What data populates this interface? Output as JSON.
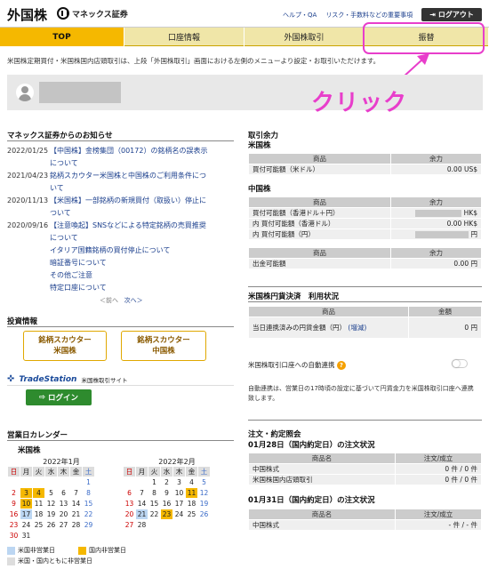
{
  "header": {
    "title": "外国株",
    "brand": "マネックス証券",
    "links": [
      "ヘルプ・QA",
      "リスク・手数料などの重要事項"
    ],
    "logout": "ログアウト"
  },
  "nav": {
    "tabs": [
      "TOP",
      "口座情報",
      "外国株取引",
      "振替"
    ]
  },
  "info_text": "米国株定期買付・米国株国内店頭取引は、上段「外国株取引」画面における左側のメニューより設定・お取引いただけます。",
  "annotation": "クリック",
  "news": {
    "title": "マネックス証券からのお知らせ",
    "items": [
      {
        "date": "2022/01/25",
        "lines": [
          "【中国株】金榜集団（00172）の銘柄名の誤表示",
          "について"
        ]
      },
      {
        "date": "2021/04/23",
        "lines": [
          "銘柄スカウター米国株と中国株のご利用条件につ",
          "いて"
        ]
      },
      {
        "date": "2020/11/13",
        "lines": [
          "【米国株】一部銘柄の新規買付（取扱い）停止に",
          "ついて"
        ]
      },
      {
        "date": "2020/09/16",
        "lines": [
          "【注意喚起】SNSなどによる特定銘柄の売買推奨",
          "について",
          "イタリア国籍銘柄の買付停止について",
          "暗証番号について",
          "その他ご注意",
          "特定口座について"
        ]
      }
    ],
    "prev": "＜前へ",
    "next": "次へ＞"
  },
  "invest": {
    "title": "投資情報",
    "buttons": [
      {
        "l1": "銘柄スカウター",
        "l2": "米国株"
      },
      {
        "l1": "銘柄スカウター",
        "l2": "中国株"
      }
    ]
  },
  "tradestation": {
    "logo": "TradeStation",
    "label": "米国株取引サイト",
    "login": "ログイン"
  },
  "calendar": {
    "title": "営業日カレンダー",
    "subtitle": "米国株",
    "weekdays": [
      "日",
      "月",
      "火",
      "水",
      "木",
      "金",
      "土"
    ],
    "months": [
      {
        "title": "2022年1月",
        "weeks": [
          [
            "",
            "",
            "",
            "",
            "",
            "",
            "1"
          ],
          [
            "2",
            "3",
            "4",
            "5",
            "6",
            "7",
            "8"
          ],
          [
            "9",
            "10",
            "11",
            "12",
            "13",
            "14",
            "15"
          ],
          [
            "16",
            "17",
            "18",
            "19",
            "20",
            "21",
            "22"
          ],
          [
            "23",
            "24",
            "25",
            "26",
            "27",
            "28",
            "29"
          ],
          [
            "30",
            "31",
            "",
            "",
            "",
            "",
            ""
          ]
        ]
      },
      {
        "title": "2022年2月",
        "weeks": [
          [
            "",
            "",
            "1",
            "2",
            "3",
            "4",
            "5"
          ],
          [
            "6",
            "7",
            "8",
            "9",
            "10",
            "11",
            "12"
          ],
          [
            "13",
            "14",
            "15",
            "16",
            "17",
            "18",
            "19"
          ],
          [
            "20",
            "21",
            "22",
            "23",
            "24",
            "25",
            "26"
          ],
          [
            "27",
            "28",
            "",
            "",
            "",
            "",
            ""
          ]
        ]
      }
    ],
    "legend": [
      "米国非営業日",
      "国内非営業日",
      "米国・国内ともに非営業日"
    ]
  },
  "balance": {
    "title": "取引余力",
    "us_title": "米国株",
    "cn_title": "中国株",
    "col_item": "商品",
    "col_amount": "余力",
    "us_rows": [
      {
        "label": "買付可能額（米ドル）",
        "value": "0.00 US$"
      }
    ],
    "cn_rows": [
      {
        "label": "買付可能額（香港ドル＋円）",
        "value": "HK$"
      },
      {
        "label": "内 買付可能額（香港ドル）",
        "value": "0.00 HK$"
      },
      {
        "label": "内 買付可能額（円）",
        "value": "円"
      }
    ],
    "out_row": {
      "label": "出金可能額",
      "value": "0.00 円"
    }
  },
  "yen_settle": {
    "title": "米国株円貨決済　利用状況",
    "col_item": "商品",
    "col_amount": "金額",
    "label": "当日連携済みの円貨金額（円）",
    "link": "(増減)",
    "value": "0 円",
    "auto_label": "米国株取引口座への自動連携",
    "note": "自動連携は、営業日の17時頃の設定に基づいて円貨金力を米国株取引口座へ連携致します。"
  },
  "orders": {
    "title": "注文・約定照会",
    "sub1": "01月28日（国内約定日）の注文状況",
    "sub2": "01月31日（国内約定日）の注文状況",
    "col_item": "商品名",
    "col_status": "注文/成立",
    "rows1": [
      {
        "label": "中国株式",
        "value": "0 件 / 0 件"
      },
      {
        "label": "米国株国内店頭取引",
        "value": "0 件 / 0 件"
      }
    ],
    "rows2": [
      {
        "label": "中国株式",
        "value": "- 件 / - 件"
      }
    ]
  },
  "colors": {
    "accent": "#f5b800",
    "nav_bg": "#f0e6a8",
    "annotation": "#e83ecb",
    "link": "#1a3e8c"
  }
}
